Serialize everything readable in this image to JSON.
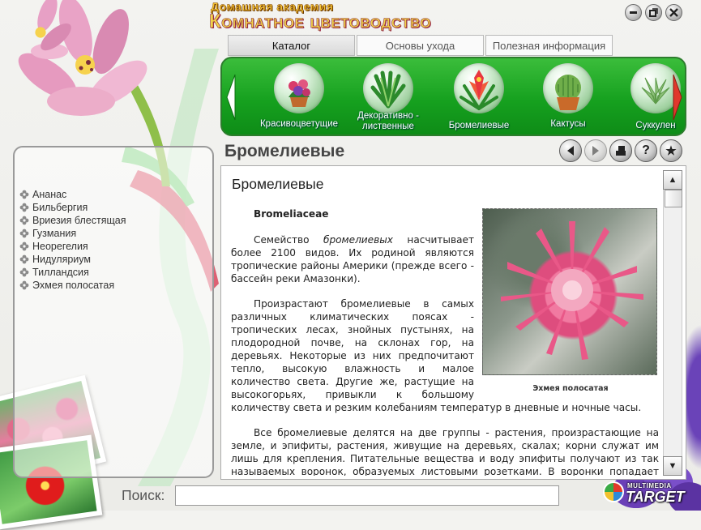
{
  "header": {
    "subtitle": "Домашняя академия",
    "title": "Комнатное цветоводство",
    "window_buttons": [
      "minimize-icon",
      "restore-icon",
      "close-icon"
    ]
  },
  "tabs": [
    {
      "label": "Каталог",
      "active": true
    },
    {
      "label": "Основы ухода",
      "active": false
    },
    {
      "label": "Полезная информация",
      "active": false
    }
  ],
  "categories": [
    {
      "label": "Красивоцветущие",
      "icon": "flowering-plant-icon"
    },
    {
      "label": "Декоративно - лиственные",
      "icon": "foliage-plant-icon"
    },
    {
      "label": "Бромелиевые",
      "icon": "bromeliad-icon",
      "selected": true
    },
    {
      "label": "Кактусы",
      "icon": "cactus-icon"
    },
    {
      "label": "Суккулен",
      "icon": "succulent-icon"
    }
  ],
  "section_title": "Бромелиевые",
  "nav_buttons": [
    "back-icon",
    "forward-icon",
    "print-icon",
    "help-icon",
    "bookmark-star-icon"
  ],
  "species": [
    "Ананас",
    "Бильбергия",
    "Вриезия блестящая",
    "Гузмания",
    "Неорегелия",
    "Нидуляриум",
    "Тилландсия",
    "Эхмея полосатая"
  ],
  "article": {
    "heading": "Бромелиевые",
    "latin": "Bromeliaceae",
    "p1_before": "Семейство ",
    "p1_italic": "бромелиевых",
    "p1_after": " насчитывает более 2100 видов. Их родиной являются тропические районы Америки (прежде всего - бассейн реки Амазонки).",
    "p2": "Произрастают бромелиевые в самых различных климатических поясах - тропических лесах, знойных пустынях, на плодородной почве, на склонах гор, на деревьях. Некоторые из них предпочитают тепло, высокую влажность и малое количество света. Другие же, растущие на высокогорьях, привыкли к большому количеству света и резким колебаниям температур в дневные и ночные часы.",
    "p3": "Все бромелиевые делятся на две группы - растения, произрастающие на земле, и эпифиты, растения, живущие на деревьях, скалах; корни служат им лишь для крепления. Питательные вещества и воду эпифиты получают из так называемых воронок, образуемых листовыми розетками. В воронки попадает также и довольно",
    "figure_caption": "Эхмея полосатая"
  },
  "search": {
    "label": "Поиск:",
    "value": ""
  },
  "logo": {
    "small": "MULTIMEDIA",
    "big": "TARGET"
  },
  "colors": {
    "carousel_green": "#16a11f",
    "title_gold": "#f2d24a",
    "title_outline": "#a0304c"
  }
}
